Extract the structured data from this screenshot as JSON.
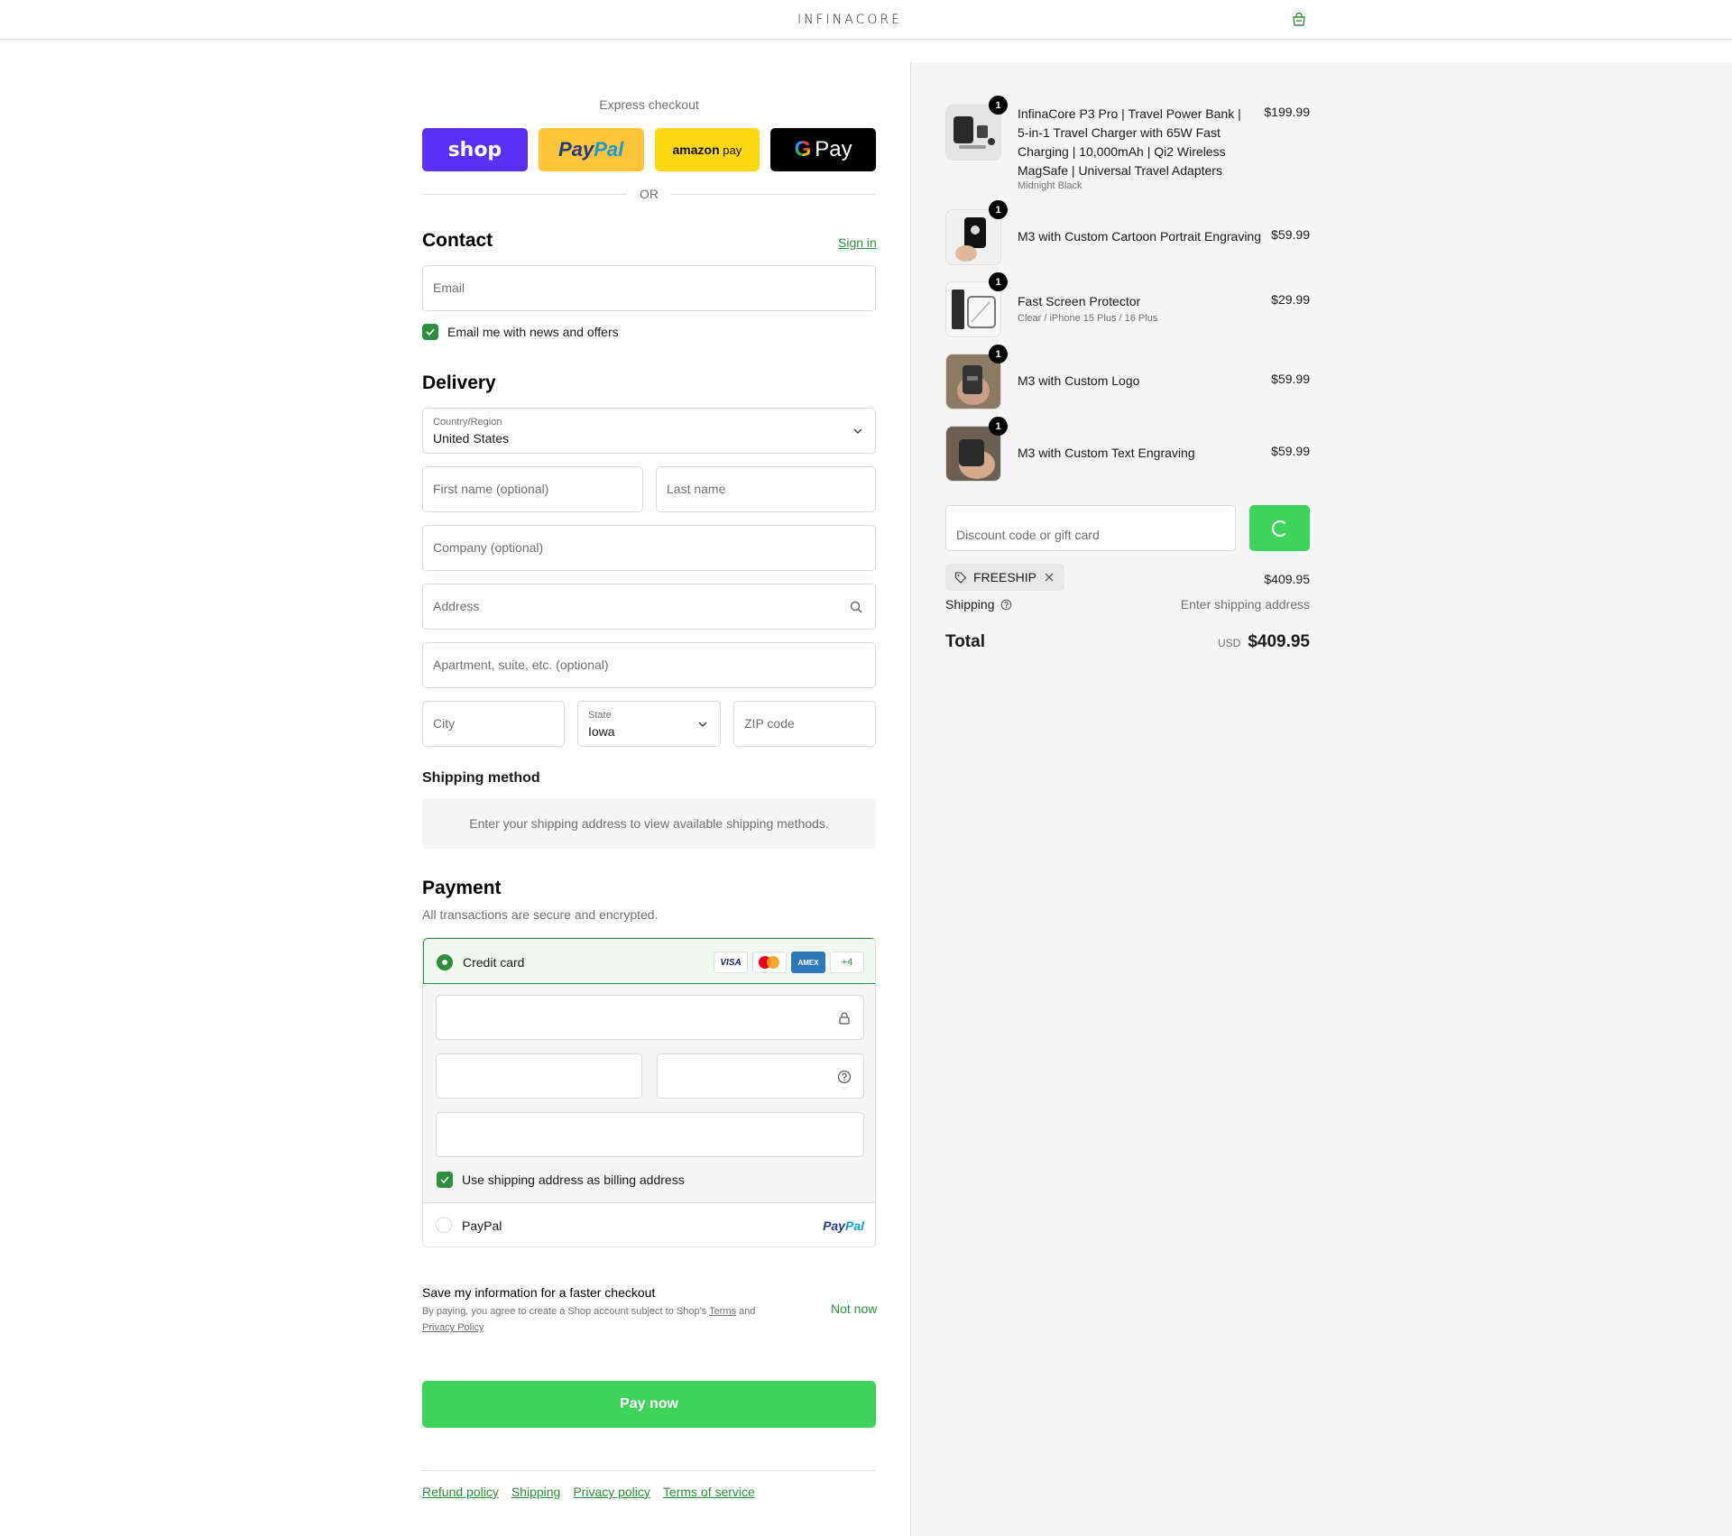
{
  "header": {
    "logo": "INFINACORE",
    "cart_icon": "bag-icon"
  },
  "express": {
    "title": "Express checkout",
    "shop": "shop",
    "paypal_a": "Pay",
    "paypal_b": "Pal",
    "amazon_a": "amazon",
    "amazon_b": "pay",
    "gpay_g": "G",
    "gpay": "Pay",
    "or": "OR"
  },
  "contact": {
    "heading": "Contact",
    "sign_in": "Sign in",
    "email_placeholder": "Email",
    "news_label": "Email me with news and offers"
  },
  "delivery": {
    "heading": "Delivery",
    "country_label": "Country/Region",
    "country_value": "United States",
    "first_name": "First name (optional)",
    "last_name": "Last name",
    "company": "Company (optional)",
    "address": "Address",
    "apartment": "Apartment, suite, etc. (optional)",
    "city": "City",
    "state_label": "State",
    "state_value": "Iowa",
    "zip": "ZIP code"
  },
  "shipping_method": {
    "heading": "Shipping method",
    "message": "Enter your shipping address to view available shipping methods."
  },
  "payment": {
    "heading": "Payment",
    "subtitle": "All transactions are secure and encrypted.",
    "credit_card": "Credit card",
    "cards": [
      "VISA",
      "AMEX",
      "+4"
    ],
    "billing_label": "Use shipping address as billing address",
    "paypal": "PayPal",
    "paypal_logo_a": "Pay",
    "paypal_logo_b": "Pal"
  },
  "save": {
    "title": "Save my information for a faster checkout",
    "sub_a": "By paying, you agree to create a Shop account subject to Shop's ",
    "terms": "Terms",
    "sub_b": " and ",
    "privacy": "Privacy Policy",
    "not_now": "Not now"
  },
  "pay_now": "Pay now",
  "footer": [
    "Refund policy",
    "Shipping",
    "Privacy policy",
    "Terms of service"
  ],
  "summary": {
    "items": [
      {
        "qty": "1",
        "name": "InfinaCore P3 Pro | Travel Power Bank | 5-in-1 Travel Charger with 65W Fast Charging | 10,000mAh | Qi2 Wireless MagSafe | Universal Travel Adapters",
        "variant": "Midnight Black",
        "price": "$199.99"
      },
      {
        "qty": "1",
        "name": "M3 with Custom Cartoon Portrait Engraving",
        "variant": "",
        "price": "$59.99"
      },
      {
        "qty": "1",
        "name": "Fast Screen Protector",
        "variant": "Clear / iPhone 15 Plus / 16 Plus",
        "price": "$29.99"
      },
      {
        "qty": "1",
        "name": "M3 with Custom Logo",
        "variant": "",
        "price": "$59.99"
      },
      {
        "qty": "1",
        "name": "M3 with Custom Text Engraving",
        "variant": "",
        "price": "$59.99"
      }
    ],
    "discount_placeholder": "Discount code or gift card",
    "code": "FREESHIP",
    "subtotal": "$409.95",
    "shipping_label": "Shipping",
    "shipping_value": "Enter shipping address",
    "total_label": "Total",
    "currency": "USD",
    "total": "$409.95"
  },
  "colors": {
    "accent": "#2d8f3b",
    "button": "#3ed45c",
    "shop": "#5a31f4",
    "paypal": "#ffc439",
    "amazon": "#ffd814"
  }
}
